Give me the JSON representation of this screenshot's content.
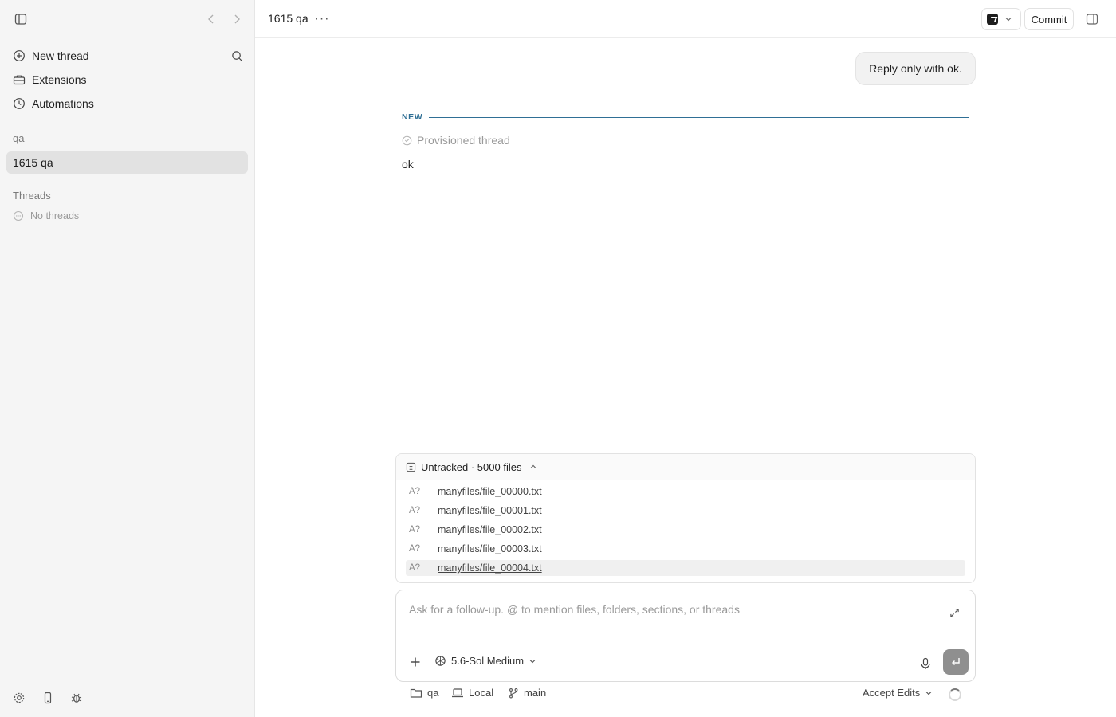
{
  "sidebar": {
    "nav": [
      {
        "label": "New thread",
        "icon": "plus-circle-icon"
      },
      {
        "label": "Extensions",
        "icon": "toolbox-icon"
      },
      {
        "label": "Automations",
        "icon": "clock-icon"
      }
    ],
    "project_section": "qa",
    "project_item": "1615 qa",
    "threads_section": "Threads",
    "no_threads": "No threads"
  },
  "header": {
    "title": "1615 qa",
    "more": "···",
    "commit_label": "Commit"
  },
  "conversation": {
    "user_message": "Reply only with ok.",
    "new_label": "NEW",
    "provisioned_label": "Provisioned thread",
    "assistant_reply": "ok"
  },
  "files_panel": {
    "title": "Untracked · 5000 files",
    "files": [
      {
        "status": "A?",
        "name": "manyfiles/file_00000.txt"
      },
      {
        "status": "A?",
        "name": "manyfiles/file_00001.txt"
      },
      {
        "status": "A?",
        "name": "manyfiles/file_00002.txt"
      },
      {
        "status": "A?",
        "name": "manyfiles/file_00003.txt"
      },
      {
        "status": "A?",
        "name": "manyfiles/file_00004.txt"
      }
    ]
  },
  "composer": {
    "placeholder": "Ask for a follow-up. @ to mention files, folders, sections, or threads",
    "model": "5.6-Sol Medium"
  },
  "statusbar": {
    "folder": "qa",
    "environment": "Local",
    "branch": "main",
    "mode": "Accept Edits"
  },
  "colors": {
    "accent_divider": "#2f6f95",
    "sidebar_bg": "#f5f5f5",
    "selected_bg": "#e2e2e2"
  }
}
